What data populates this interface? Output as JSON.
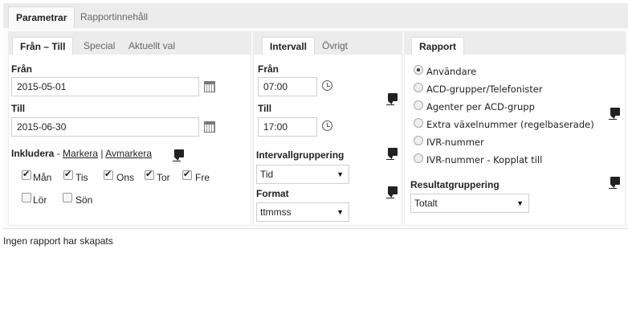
{
  "top_tabs": {
    "params": "Parametrar",
    "content": "Rapportinnehåll"
  },
  "date_panel": {
    "tabs": {
      "range": "Från – Till",
      "special": "Special",
      "current": "Aktuellt val"
    },
    "from_label": "Från",
    "from_value": "2015-05-01",
    "to_label": "Till",
    "to_value": "2015-06-30",
    "include_label": "Inkludera",
    "dash": "-",
    "mark": "Markera",
    "sep": "|",
    "unmark": "Avmarkera",
    "days": [
      {
        "label": "Mån",
        "checked": true
      },
      {
        "label": "Tis",
        "checked": true
      },
      {
        "label": "Ons",
        "checked": true
      },
      {
        "label": "Tor",
        "checked": true
      },
      {
        "label": "Fre",
        "checked": true
      },
      {
        "label": "Lör",
        "checked": false
      },
      {
        "label": "Sön",
        "checked": false
      }
    ]
  },
  "interval_panel": {
    "tabs": {
      "interval": "Intervall",
      "other": "Övrigt"
    },
    "from_label": "Från",
    "from_value": "07:00",
    "to_label": "Till",
    "to_value": "17:00",
    "grouping_label": "Intervallgruppering",
    "grouping_value": "Tid",
    "format_label": "Format",
    "format_value": "ttmmss"
  },
  "report_panel": {
    "tab": "Rapport",
    "options": [
      {
        "label": "Användare",
        "selected": true
      },
      {
        "label": "ACD-grupper/Telefonister",
        "selected": false
      },
      {
        "label": "Agenter per ACD-grupp",
        "selected": false
      },
      {
        "label": "Extra växelnummer (regelbaserade)",
        "selected": false
      },
      {
        "label": "IVR-nummer",
        "selected": false
      },
      {
        "label": "IVR-nummer - Kopplat till",
        "selected": false
      }
    ],
    "result_grouping_label": "Resultatgruppering",
    "result_grouping_value": "Totalt"
  },
  "status": "Ingen rapport har skapats",
  "icons": {
    "calendar": "calendar-icon",
    "clock": "clock-icon",
    "comment": "comment-icon",
    "dropdown": "chevron-down-icon"
  }
}
